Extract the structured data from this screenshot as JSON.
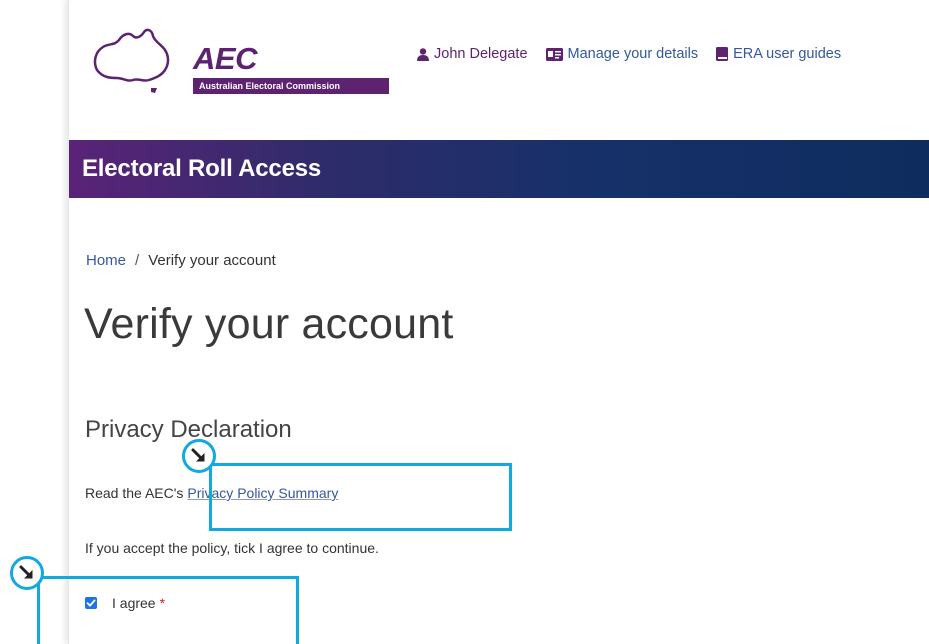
{
  "header": {
    "logo": {
      "acronym": "AEC",
      "full_name": "Australian Electoral Commission"
    },
    "nav": [
      {
        "label": "John Delegate",
        "icon": "user-icon"
      },
      {
        "label": "Manage your details",
        "icon": "id-card-icon"
      },
      {
        "label": "ERA user guides",
        "icon": "book-icon"
      }
    ]
  },
  "banner": {
    "title": "Electoral Roll Access"
  },
  "breadcrumb": {
    "home": "Home",
    "separator": "/",
    "current": "Verify your account"
  },
  "page": {
    "title": "Verify your account",
    "section_title": "Privacy Declaration",
    "read_prefix": "Read the AEC's",
    "policy_link": "Privacy Policy Summary",
    "accept_text": "If you accept the policy, tick I agree to continue.",
    "agree_label": "I agree",
    "required_mark": "*",
    "agree_checked": true
  },
  "annotations": {
    "marker_icon": "arrow-down-right-icon",
    "highlight_color": "#12a8e0"
  },
  "colors": {
    "brand_purple": "#5e2370",
    "link_blue": "#33589c",
    "banner_start": "#5a2378",
    "banner_end": "#0e2d5e",
    "required_red": "#d42020",
    "checkbox_blue": "#1a73e8"
  }
}
